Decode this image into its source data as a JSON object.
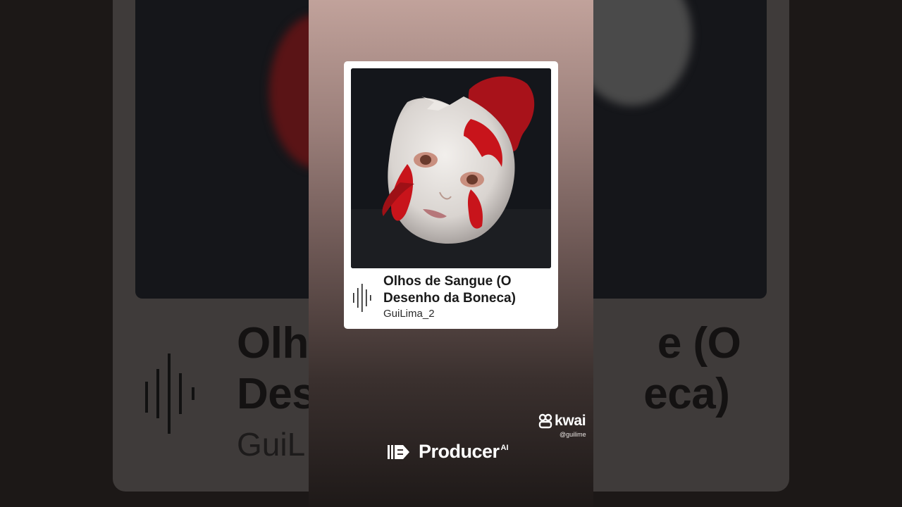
{
  "song": {
    "title": "Olhos de Sangue (O Desenho da Boneca)",
    "artist": "GuiLima_2"
  },
  "background": {
    "title_fragment_left": "Olh",
    "title_fragment_right": "e (O",
    "title_fragment_left_2": "Des",
    "title_fragment_right_2": "eca)",
    "artist_fragment": "GuiL"
  },
  "watermark": {
    "brand": "kwai",
    "handle": "@guilime"
  },
  "branding": {
    "name": "Producer",
    "superscript": "AI"
  },
  "colors": {
    "card": "#ffffff",
    "blood": "#c8141b",
    "text_dark": "#1a1a1a"
  },
  "icons": {
    "sound": "waveform-icon",
    "kwai": "kwai-logo-icon",
    "producer": "producer-logo-icon"
  }
}
